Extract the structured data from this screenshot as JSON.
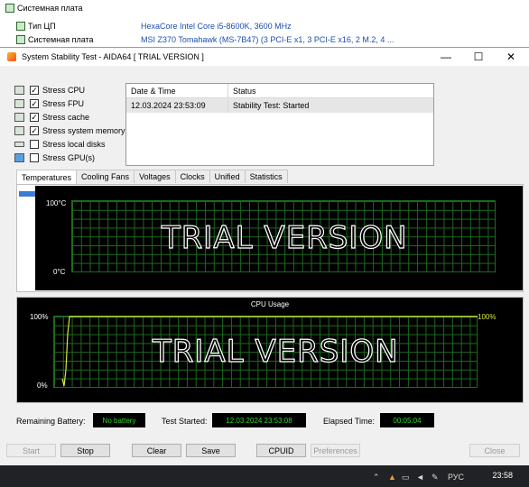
{
  "background": {
    "rows": [
      {
        "label": "Системная плата",
        "value": ""
      },
      {
        "label": "Тип ЦП",
        "value": "HexaCore Intel Core i5-8600K, 3600 MHz"
      },
      {
        "label": "Системная плата",
        "value": "MSI Z370 Tomahawk (MS-7B47)  (3 PCI-E x1, 3 PCI-E x16, 2 M.2, 4 ..."
      }
    ]
  },
  "dialog": {
    "title": "System Stability Test - AIDA64  [ TRIAL VERSION ]",
    "window_buttons": {
      "minimize": "—",
      "maximize": "☐",
      "close": "✕"
    },
    "checks": [
      {
        "label": "Stress CPU",
        "checked": true,
        "icon": "cpu-icon"
      },
      {
        "label": "Stress FPU",
        "checked": true,
        "icon": "fpu-icon"
      },
      {
        "label": "Stress cache",
        "checked": true,
        "icon": "cache-icon"
      },
      {
        "label": "Stress system memory",
        "checked": true,
        "icon": "memory-icon"
      },
      {
        "label": "Stress local disks",
        "checked": false,
        "icon": "disk-icon"
      },
      {
        "label": "Stress GPU(s)",
        "checked": false,
        "icon": "monitor-icon"
      }
    ],
    "log": {
      "headers": [
        "Date & Time",
        "Status"
      ],
      "rows": [
        [
          "12.03.2024 23:53:09",
          "Stability Test: Started"
        ]
      ]
    },
    "tabs": [
      "Temperatures",
      "Cooling Fans",
      "Voltages",
      "Clocks",
      "Unified",
      "Statistics"
    ],
    "active_tab": "Temperatures",
    "temp_graph": {
      "y_max_label": "100°C",
      "y_min_label": "0°C",
      "watermark": "TRIAL VERSION"
    },
    "cpu_graph": {
      "title": "CPU Usage",
      "y_max_label": "100%",
      "y_min_label": "0%",
      "current_label": "100%",
      "watermark": "TRIAL VERSION",
      "line_color": "#d7ea3a"
    },
    "status": {
      "remaining_battery_label": "Remaining Battery:",
      "remaining_battery_value": "No battery",
      "test_started_label": "Test Started:",
      "test_started_value": "12.03.2024 23:53:08",
      "elapsed_label": "Elapsed Time:",
      "elapsed_value": "00:05:04"
    },
    "buttons": {
      "start": "Start",
      "stop": "Stop",
      "clear": "Clear",
      "save": "Save",
      "cpuid": "CPUID",
      "preferences": "Preferences",
      "close": "Close"
    }
  },
  "taskbar": {
    "language": "РУС",
    "time": "23:58"
  },
  "colors": {
    "graph_grid": "#1d6b1d",
    "status_text": "#2bd92b",
    "accent": "#3c7bd6"
  }
}
